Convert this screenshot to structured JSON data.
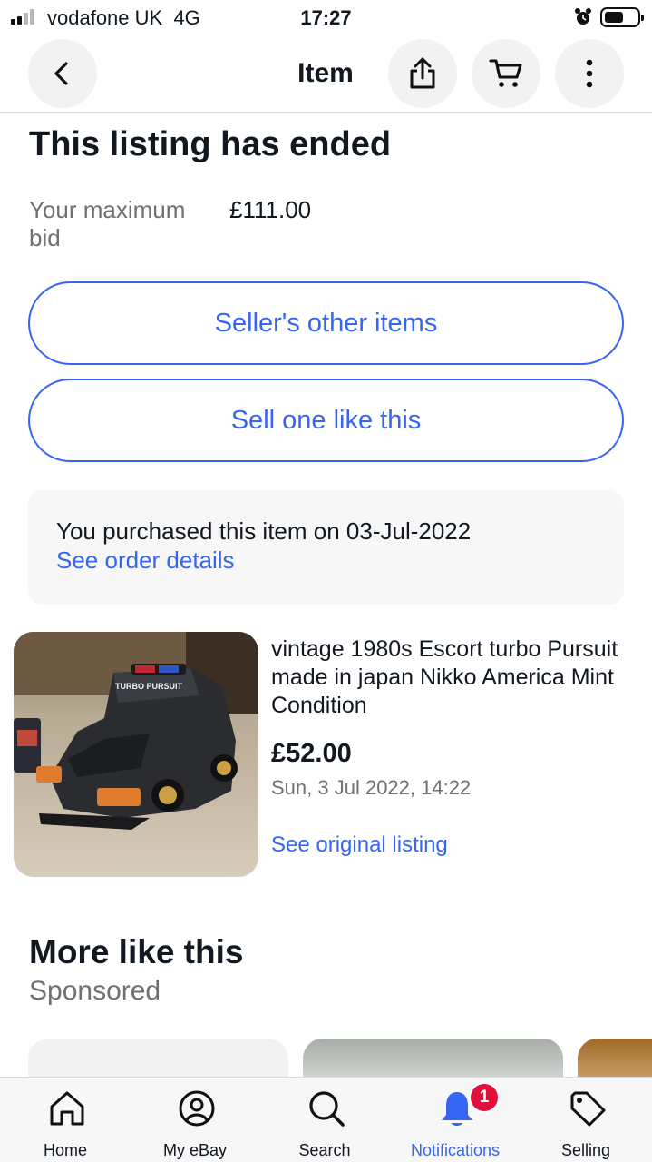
{
  "status_bar": {
    "carrier": "vodafone UK",
    "network": "4G",
    "time": "17:27",
    "signal_bars": 2,
    "battery_level": 0.5
  },
  "header": {
    "title": "Item",
    "back_icon": "chevron-left-icon",
    "share_icon": "share-icon",
    "cart_icon": "cart-icon",
    "more_icon": "more-vertical-icon"
  },
  "listing": {
    "status_title": "This listing has ended",
    "max_bid_label": "Your maximum bid",
    "max_bid_value": "£111.00",
    "seller_items_button": "Seller's other items",
    "sell_one_button": "Sell one like this",
    "purchase_notice": "You purchased this item on 03-Jul-2022",
    "order_details_link": "See order details"
  },
  "item": {
    "title": "vintage 1980s Escort turbo Pursuit made in japan Nikko America Mint Condition",
    "price": "£52.00",
    "date": "Sun, 3 Jul 2022, 14:22",
    "original_listing_link": "See original listing",
    "photo_text": "TURBO PURSUIT"
  },
  "recommendations": {
    "title": "More like this",
    "subtitle": "Sponsored"
  },
  "tab_bar": {
    "tabs": [
      {
        "label": "Home",
        "icon": "home-icon"
      },
      {
        "label": "My eBay",
        "icon": "user-icon"
      },
      {
        "label": "Search",
        "icon": "search-icon"
      },
      {
        "label": "Notifications",
        "icon": "bell-icon"
      },
      {
        "label": "Selling",
        "icon": "tag-icon"
      }
    ],
    "active": "Notifications",
    "notification_count": "1"
  },
  "colors": {
    "accent": "#3665f3",
    "text": "#111820",
    "secondary_text": "#707070",
    "badge": "#e0103a"
  }
}
